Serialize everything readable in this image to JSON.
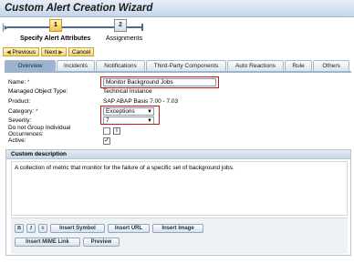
{
  "window": {
    "title": "Custom Alert Creation Wizard"
  },
  "roadmap": {
    "steps": [
      {
        "number": "1",
        "label": "Specify Alert Attributes"
      },
      {
        "number": "2",
        "label": "Assignments"
      }
    ]
  },
  "nav": {
    "previous": "Previous",
    "next": "Next",
    "cancel": "Cancel"
  },
  "tabs": [
    {
      "label": "Overview"
    },
    {
      "label": "Incidents"
    },
    {
      "label": "Notifications"
    },
    {
      "label": "Third-Party Components"
    },
    {
      "label": "Auto Reactions"
    },
    {
      "label": "Rule"
    },
    {
      "label": "Others"
    }
  ],
  "form": {
    "name_label": "Name:",
    "name_required": "*",
    "name_value": "Monitor Background Jobs",
    "mo_type_label": "Managed Object Type:",
    "mo_type_value": "Technical Instance",
    "product_label": "Product:",
    "product_value": "SAP ABAP Basis 7.00 - 7.03",
    "category_label": "Category:",
    "category_required": "*",
    "category_value": "Exceptions",
    "severity_label": "Severity:",
    "severity_value": "7",
    "no_group_label": "Do not Group Individual Occurrences:",
    "no_group_checked": "",
    "info_icon": "i",
    "active_label": "Active:",
    "active_checked": "✓"
  },
  "description": {
    "header": "Custom description",
    "text": "A collection of metric that monitor for the failure of a specific set of background jobs."
  },
  "toolbar": {
    "bold": "B",
    "italic": "I",
    "underline": "≡",
    "insert_symbol": "Insert Symbol",
    "insert_url": "Insert URL",
    "insert_image": "Insert Image",
    "insert_mime": "Insert MIME Link",
    "preview": "Preview"
  },
  "colors": {
    "highlight": "#c4161c",
    "active_tab": "#9cb4cf",
    "nav_button": "#f6d46c"
  }
}
